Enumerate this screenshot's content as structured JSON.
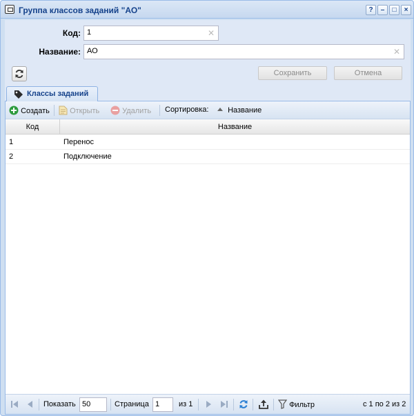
{
  "window": {
    "title": "Группа классов заданий \"АО\"",
    "tool_buttons": [
      "?",
      "–",
      "□",
      "×"
    ]
  },
  "form": {
    "code_label": "Код:",
    "code_value": "1",
    "name_label": "Название:",
    "name_value": "АО",
    "save_label": "Сохранить",
    "cancel_label": "Отмена"
  },
  "tab": {
    "label": "Классы заданий"
  },
  "toolbar": {
    "create_label": "Создать",
    "open_label": "Открыть",
    "delete_label": "Удалить",
    "sort_label": "Сортировка:",
    "sort_field_label": "Название"
  },
  "grid": {
    "columns": [
      "Код",
      "Название"
    ],
    "rows": [
      {
        "code": "1",
        "name": "Перенос"
      },
      {
        "code": "2",
        "name": "Подключение"
      }
    ]
  },
  "paging": {
    "show_label": "Показать",
    "page_size": "50",
    "page_label": "Страница",
    "page_value": "1",
    "of_label": "из 1",
    "filter_label": "Фильтр",
    "summary": "с 1 по 2 из 2"
  },
  "colors": {
    "accent": "#15428b",
    "create_icon": "#2e9b3e",
    "delete_icon": "#e06565"
  }
}
